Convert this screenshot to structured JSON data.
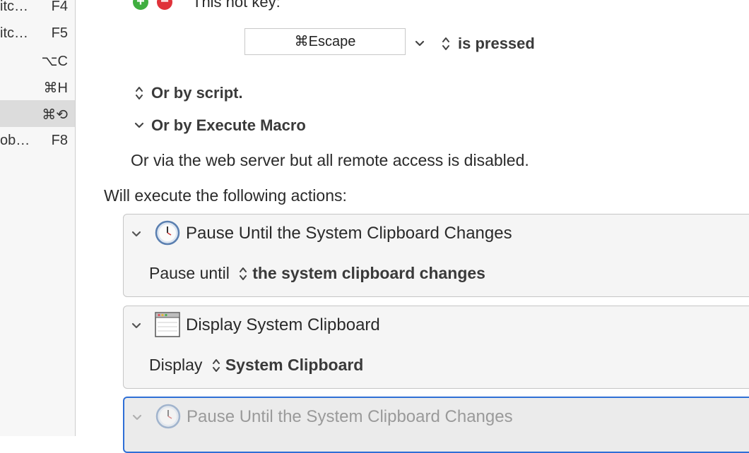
{
  "sidebar": {
    "rows": [
      {
        "name": "itc…",
        "key": "F4"
      },
      {
        "name": "itc…",
        "key": "F5"
      },
      {
        "name": "",
        "key": "⌥C"
      },
      {
        "name": "",
        "key": "⌘H"
      },
      {
        "name": "",
        "key": "⌘⟲"
      },
      {
        "name": "ob…",
        "key": "F8"
      }
    ]
  },
  "trigger": {
    "hotkey_label": "This hot key:",
    "hotkey_value": "⌘Escape",
    "hotkey_condition": "is pressed",
    "by_script": "Or by script.",
    "by_execute_macro": "Or by Execute Macro",
    "web_server_text": "Or via the web server but all remote access is disabled."
  },
  "actions_header": "Will execute the following actions:",
  "actions": [
    {
      "title": "Pause Until the System Clipboard Changes",
      "body_prefix": "Pause until",
      "body_value": "the system clipboard changes",
      "icon": "clock-icon"
    },
    {
      "title": "Display System Clipboard",
      "body_prefix": "Display",
      "body_value": "System Clipboard",
      "icon": "window-icon"
    },
    {
      "title": "Pause Until the System Clipboard Changes",
      "icon": "clock-icon"
    }
  ],
  "colors": {
    "accent": "#2f6fd6",
    "add": "#3fae3f",
    "remove": "#e0323a"
  }
}
